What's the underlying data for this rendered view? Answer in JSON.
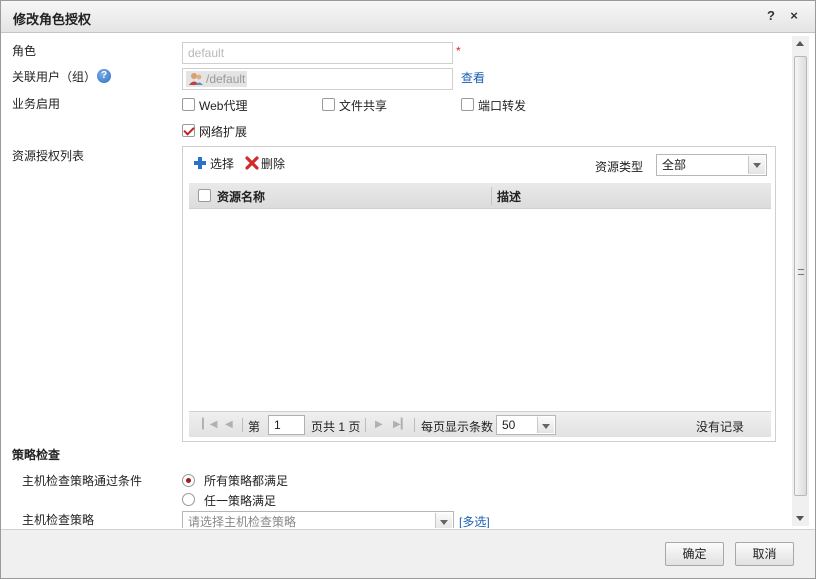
{
  "dialog": {
    "title": "修改角色授权",
    "help_button": "?",
    "close_button": "×"
  },
  "form": {
    "role_label": "角色",
    "role_value": "default",
    "required_mark": "*",
    "linked_users_label": "关联用户（组）",
    "help_icon_glyph": "?",
    "linked_user_value": "/default",
    "view_link": "查看",
    "business_label": "业务启用",
    "services": [
      {
        "label": "Web代理",
        "checked": false
      },
      {
        "label": "文件共享",
        "checked": false
      },
      {
        "label": "端口转发",
        "checked": false
      },
      {
        "label": "网络扩展",
        "checked": true
      }
    ],
    "resource_list_label": "资源授权列表"
  },
  "resources": {
    "select_button": "选择",
    "delete_button": "删除",
    "type_label": "资源类型",
    "type_value": "全部",
    "columns": [
      "资源名称",
      "描述"
    ],
    "rows": []
  },
  "pager": {
    "page_prefix": "第",
    "page_value": "1",
    "page_suffix": "页共 1 页",
    "per_page_label": "每页显示条数",
    "per_page_value": "50",
    "empty_text": "没有记录"
  },
  "policy": {
    "section_title": "策略检查",
    "pass_condition_label": "主机检查策略通过条件",
    "options": [
      {
        "label": "所有策略都满足",
        "selected": true
      },
      {
        "label": "任一策略满足",
        "selected": false
      }
    ],
    "policy_label": "主机检查策略",
    "policy_placeholder": "请选择主机检查策略",
    "multi_select_link": "[多选]"
  },
  "footer": {
    "ok_button": "确定",
    "cancel_button": "取消"
  },
  "colors": {
    "link": "#1a5fb4",
    "required": "#e02020",
    "delete_icon": "#d42a2a",
    "add_icon": "#2b73c8"
  }
}
